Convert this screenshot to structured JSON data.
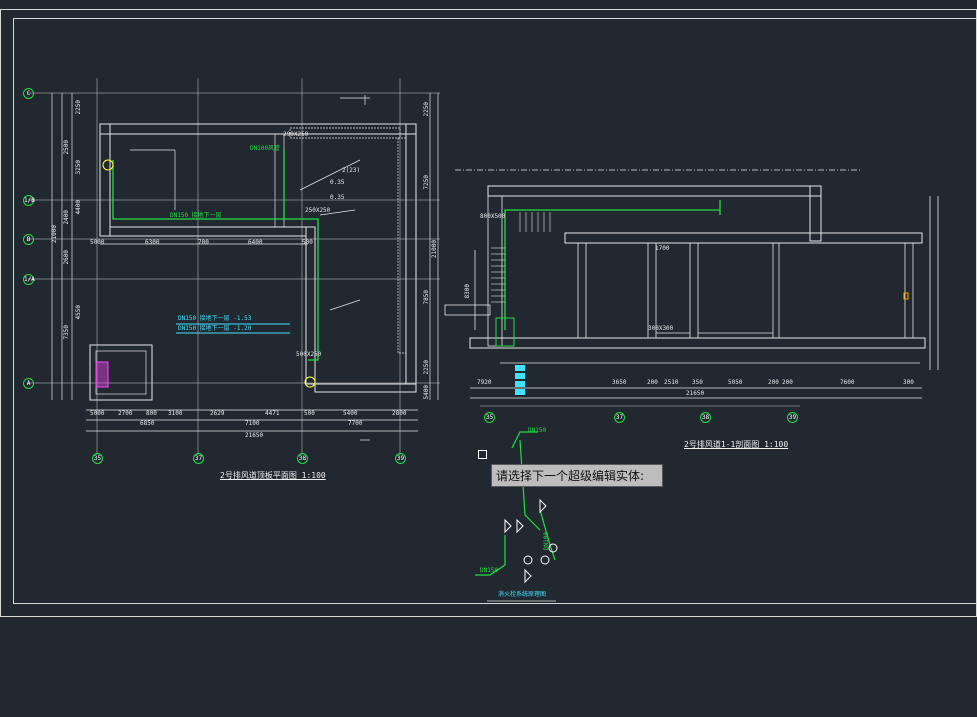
{
  "prompt": {
    "text": "请选择下一个超级编辑实体:"
  },
  "plan": {
    "title": "2号排风道顶板平面图  1:100",
    "axes_bottom": [
      "35",
      "37",
      "38",
      "39"
    ],
    "axes_left": [
      "C",
      "1/B",
      "B",
      "1/A",
      "A"
    ],
    "dims_bottom_row1": [
      "5000",
      "2700",
      "800",
      "3100",
      "2629",
      "4471",
      "500",
      "5400",
      "2800"
    ],
    "dims_bottom_row2": [
      "6850",
      "7100",
      "7700"
    ],
    "dims_bottom_total": "21650",
    "dims_top_row": [
      "5000",
      "6300",
      "700",
      "6400",
      "500"
    ],
    "dims_left": [
      "2250",
      "3250",
      "4400",
      "2400",
      "2600",
      "4550",
      "7350",
      "2500"
    ],
    "dims_left_total": "21000",
    "dims_right": [
      "2250",
      "7250",
      "21000",
      "7850",
      "2250",
      "5400"
    ],
    "pipe_labels": [
      "DN100风管",
      "DN150 接地下一层",
      "DN150 接地下一层 -1.53",
      "DN150 接地下一层 -1.20"
    ],
    "notes": [
      "2(23)",
      "0.35",
      "0.35",
      "250X250",
      "290X250",
      "500X250"
    ]
  },
  "section": {
    "title": "2号排风道1-1剖面图  1:100",
    "axes_bottom": [
      "35",
      "37",
      "38",
      "39"
    ],
    "dims_bottom_row1": [
      "7920",
      "3650",
      "200",
      "2510",
      "350",
      "5050",
      "200",
      "200",
      "7600",
      "300"
    ],
    "dims_bottom_total": "21650",
    "notes": [
      "800X500",
      "1700",
      "300X300",
      "8300"
    ]
  },
  "detail": {
    "title": "消火栓系统原理图",
    "notes": [
      "DN150",
      "DN100",
      "DN150"
    ]
  },
  "colors": {
    "background": "#212830",
    "line": "#e6e6e6",
    "pipe": "#22dd44",
    "dim": "#e6e6e6",
    "tooltip_bg": "#bdbdbd"
  }
}
